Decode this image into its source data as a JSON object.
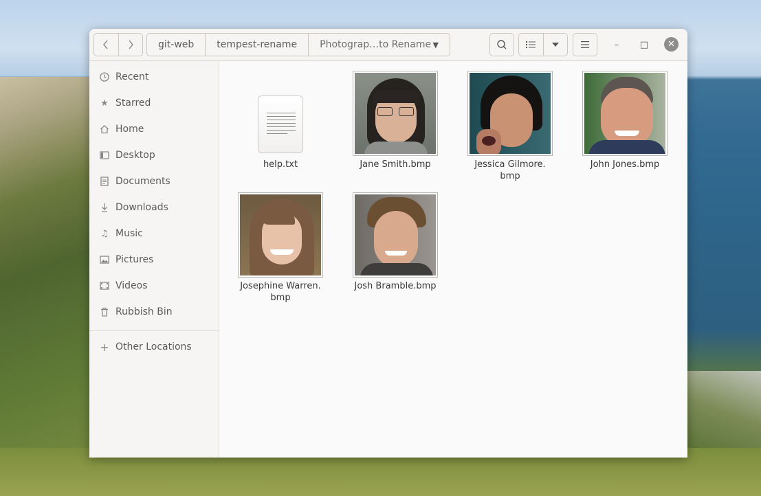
{
  "window": {
    "nav": {
      "back_icon": "chevron-left-icon",
      "forward_icon": "chevron-right-icon"
    },
    "breadcrumbs": [
      "git-web",
      "tempest-rename",
      "Photograp…to Rename"
    ],
    "toolbar": {
      "search_icon": "search-icon",
      "view_icon": "list-view-icon",
      "view_dropdown_icon": "chevron-down-icon",
      "menu_icon": "hamburger-menu-icon"
    },
    "controls": {
      "minimize": "–",
      "maximize": "□",
      "close": "✕"
    }
  },
  "sidebar": {
    "items": [
      {
        "label": "Recent",
        "icon": "clock-icon"
      },
      {
        "label": "Starred",
        "icon": "star-icon"
      },
      {
        "label": "Home",
        "icon": "home-icon"
      },
      {
        "label": "Desktop",
        "icon": "desktop-icon"
      },
      {
        "label": "Documents",
        "icon": "document-icon"
      },
      {
        "label": "Downloads",
        "icon": "download-icon"
      },
      {
        "label": "Music",
        "icon": "music-icon"
      },
      {
        "label": "Pictures",
        "icon": "pictures-icon"
      },
      {
        "label": "Videos",
        "icon": "video-icon"
      },
      {
        "label": "Rubbish Bin",
        "icon": "trash-icon"
      }
    ],
    "other": {
      "label": "Other Locations",
      "icon": "plus-icon"
    }
  },
  "files": [
    {
      "line1": "help.txt",
      "line2": "",
      "type": "text"
    },
    {
      "line1": "Jane Smith.bmp",
      "line2": "",
      "type": "image"
    },
    {
      "line1": "Jessica Gilmore.",
      "line2": "bmp",
      "type": "image"
    },
    {
      "line1": "John Jones.bmp",
      "line2": "",
      "type": "image"
    },
    {
      "line1": "Josephine Warren.",
      "line2": "bmp",
      "type": "image"
    },
    {
      "line1": "Josh Bramble.bmp",
      "line2": "",
      "type": "image"
    }
  ],
  "colors": {
    "window_bg": "#fafafa",
    "sidebar_bg": "#f6f5f4",
    "close_button": "#8f8d8b"
  }
}
